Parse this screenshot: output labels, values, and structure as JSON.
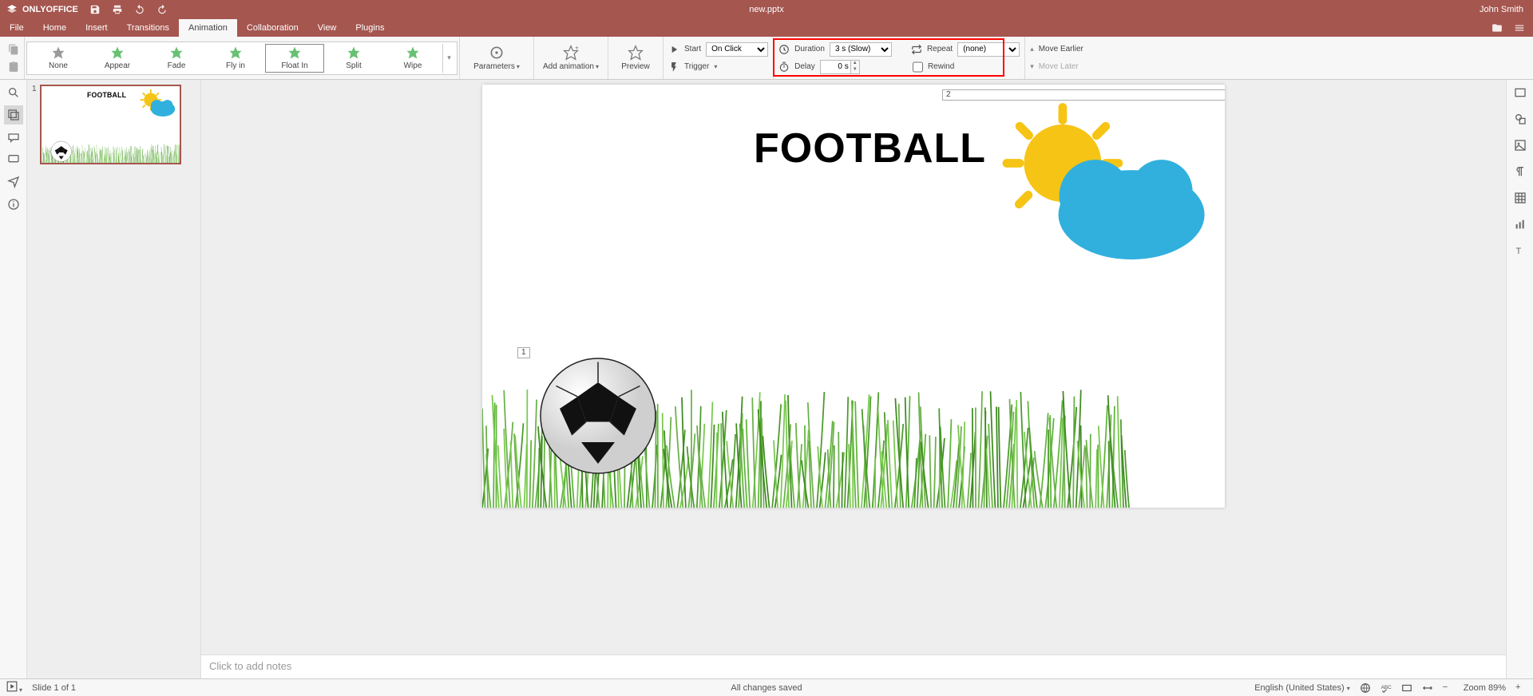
{
  "app": {
    "name": "ONLYOFFICE",
    "filename": "new.pptx",
    "user": "John Smith"
  },
  "menu": {
    "items": [
      "File",
      "Home",
      "Insert",
      "Transitions",
      "Animation",
      "Collaboration",
      "View",
      "Plugins"
    ],
    "active_index": 4
  },
  "ribbon": {
    "effects": [
      "None",
      "Appear",
      "Fade",
      "Fly in",
      "Float In",
      "Split",
      "Wipe"
    ],
    "selected_effect_index": 4,
    "parameters": "Parameters",
    "add_animation": "Add animation",
    "preview": "Preview",
    "start_label": "Start",
    "start_value": "On Click",
    "trigger": "Trigger",
    "duration_label": "Duration",
    "duration_value": "3 s (Slow)",
    "delay_label": "Delay",
    "delay_value": "0 s",
    "repeat_label": "Repeat",
    "repeat_value": "(none)",
    "rewind_label": "Rewind",
    "move_earlier": "Move Earlier",
    "move_later": "Move Later"
  },
  "slide": {
    "number": "1",
    "title": "FOOTBALL",
    "badge1": "1",
    "badge2": "2"
  },
  "notes_placeholder": "Click to add notes",
  "status": {
    "slide_info": "Slide 1 of 1",
    "save_state": "All changes saved",
    "language": "English (United States)",
    "zoom": "Zoom 89%"
  },
  "icons": {
    "copy": "copy",
    "paste": "paste",
    "search": "search",
    "slides": "slides",
    "comments": "comments",
    "chat": "chat",
    "feedback": "feedback",
    "info": "info",
    "shapes": "shapes",
    "image": "image",
    "paragraph": "paragraph",
    "table": "table",
    "chart": "chart",
    "text": "text"
  }
}
